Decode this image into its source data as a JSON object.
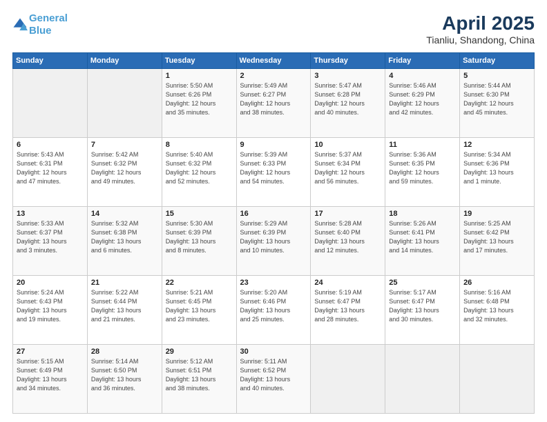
{
  "logo": {
    "line1": "General",
    "line2": "Blue"
  },
  "title": "April 2025",
  "subtitle": "Tianliu, Shandong, China",
  "header_days": [
    "Sunday",
    "Monday",
    "Tuesday",
    "Wednesday",
    "Thursday",
    "Friday",
    "Saturday"
  ],
  "weeks": [
    [
      {
        "day": "",
        "info": ""
      },
      {
        "day": "",
        "info": ""
      },
      {
        "day": "1",
        "info": "Sunrise: 5:50 AM\nSunset: 6:26 PM\nDaylight: 12 hours\nand 35 minutes."
      },
      {
        "day": "2",
        "info": "Sunrise: 5:49 AM\nSunset: 6:27 PM\nDaylight: 12 hours\nand 38 minutes."
      },
      {
        "day": "3",
        "info": "Sunrise: 5:47 AM\nSunset: 6:28 PM\nDaylight: 12 hours\nand 40 minutes."
      },
      {
        "day": "4",
        "info": "Sunrise: 5:46 AM\nSunset: 6:29 PM\nDaylight: 12 hours\nand 42 minutes."
      },
      {
        "day": "5",
        "info": "Sunrise: 5:44 AM\nSunset: 6:30 PM\nDaylight: 12 hours\nand 45 minutes."
      }
    ],
    [
      {
        "day": "6",
        "info": "Sunrise: 5:43 AM\nSunset: 6:31 PM\nDaylight: 12 hours\nand 47 minutes."
      },
      {
        "day": "7",
        "info": "Sunrise: 5:42 AM\nSunset: 6:32 PM\nDaylight: 12 hours\nand 49 minutes."
      },
      {
        "day": "8",
        "info": "Sunrise: 5:40 AM\nSunset: 6:32 PM\nDaylight: 12 hours\nand 52 minutes."
      },
      {
        "day": "9",
        "info": "Sunrise: 5:39 AM\nSunset: 6:33 PM\nDaylight: 12 hours\nand 54 minutes."
      },
      {
        "day": "10",
        "info": "Sunrise: 5:37 AM\nSunset: 6:34 PM\nDaylight: 12 hours\nand 56 minutes."
      },
      {
        "day": "11",
        "info": "Sunrise: 5:36 AM\nSunset: 6:35 PM\nDaylight: 12 hours\nand 59 minutes."
      },
      {
        "day": "12",
        "info": "Sunrise: 5:34 AM\nSunset: 6:36 PM\nDaylight: 13 hours\nand 1 minute."
      }
    ],
    [
      {
        "day": "13",
        "info": "Sunrise: 5:33 AM\nSunset: 6:37 PM\nDaylight: 13 hours\nand 3 minutes."
      },
      {
        "day": "14",
        "info": "Sunrise: 5:32 AM\nSunset: 6:38 PM\nDaylight: 13 hours\nand 6 minutes."
      },
      {
        "day": "15",
        "info": "Sunrise: 5:30 AM\nSunset: 6:39 PM\nDaylight: 13 hours\nand 8 minutes."
      },
      {
        "day": "16",
        "info": "Sunrise: 5:29 AM\nSunset: 6:39 PM\nDaylight: 13 hours\nand 10 minutes."
      },
      {
        "day": "17",
        "info": "Sunrise: 5:28 AM\nSunset: 6:40 PM\nDaylight: 13 hours\nand 12 minutes."
      },
      {
        "day": "18",
        "info": "Sunrise: 5:26 AM\nSunset: 6:41 PM\nDaylight: 13 hours\nand 14 minutes."
      },
      {
        "day": "19",
        "info": "Sunrise: 5:25 AM\nSunset: 6:42 PM\nDaylight: 13 hours\nand 17 minutes."
      }
    ],
    [
      {
        "day": "20",
        "info": "Sunrise: 5:24 AM\nSunset: 6:43 PM\nDaylight: 13 hours\nand 19 minutes."
      },
      {
        "day": "21",
        "info": "Sunrise: 5:22 AM\nSunset: 6:44 PM\nDaylight: 13 hours\nand 21 minutes."
      },
      {
        "day": "22",
        "info": "Sunrise: 5:21 AM\nSunset: 6:45 PM\nDaylight: 13 hours\nand 23 minutes."
      },
      {
        "day": "23",
        "info": "Sunrise: 5:20 AM\nSunset: 6:46 PM\nDaylight: 13 hours\nand 25 minutes."
      },
      {
        "day": "24",
        "info": "Sunrise: 5:19 AM\nSunset: 6:47 PM\nDaylight: 13 hours\nand 28 minutes."
      },
      {
        "day": "25",
        "info": "Sunrise: 5:17 AM\nSunset: 6:47 PM\nDaylight: 13 hours\nand 30 minutes."
      },
      {
        "day": "26",
        "info": "Sunrise: 5:16 AM\nSunset: 6:48 PM\nDaylight: 13 hours\nand 32 minutes."
      }
    ],
    [
      {
        "day": "27",
        "info": "Sunrise: 5:15 AM\nSunset: 6:49 PM\nDaylight: 13 hours\nand 34 minutes."
      },
      {
        "day": "28",
        "info": "Sunrise: 5:14 AM\nSunset: 6:50 PM\nDaylight: 13 hours\nand 36 minutes."
      },
      {
        "day": "29",
        "info": "Sunrise: 5:12 AM\nSunset: 6:51 PM\nDaylight: 13 hours\nand 38 minutes."
      },
      {
        "day": "30",
        "info": "Sunrise: 5:11 AM\nSunset: 6:52 PM\nDaylight: 13 hours\nand 40 minutes."
      },
      {
        "day": "",
        "info": ""
      },
      {
        "day": "",
        "info": ""
      },
      {
        "day": "",
        "info": ""
      }
    ]
  ]
}
